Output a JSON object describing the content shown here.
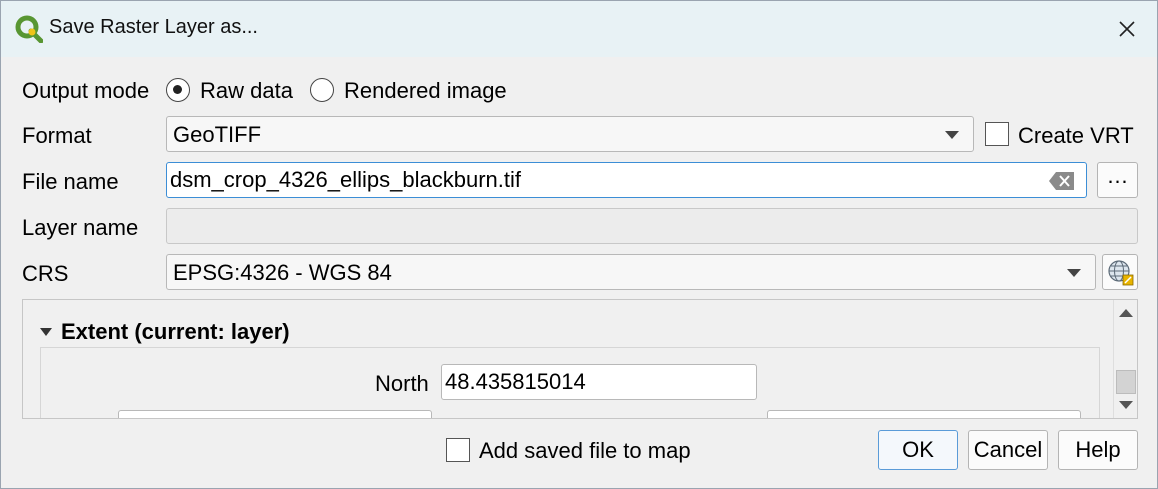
{
  "window": {
    "title": "Save Raster Layer as...",
    "app_icon": "qgis-logo-icon",
    "close_icon": "close-icon"
  },
  "output_mode": {
    "label": "Output mode",
    "options": [
      {
        "label": "Raw data",
        "checked": true
      },
      {
        "label": "Rendered image",
        "checked": false
      }
    ]
  },
  "format": {
    "label": "Format",
    "value": "GeoTIFF",
    "create_vrt_label": "Create VRT",
    "create_vrt_checked": false
  },
  "file_name": {
    "label": "File name",
    "value": "dsm_crop_4326_ellips_blackburn.tif",
    "clear_icon": "clear-text-icon",
    "browse_label": "…"
  },
  "layer_name": {
    "label": "Layer name",
    "value": ""
  },
  "crs": {
    "label": "CRS",
    "value": "EPSG:4326 - WGS 84",
    "select_icon": "globe-crs-icon"
  },
  "extent": {
    "title": "Extent (current: layer)",
    "expanded": true,
    "north_label": "North",
    "north_value": "48.435815014"
  },
  "footer": {
    "add_to_map_label": "Add saved file to map",
    "add_to_map_checked": false,
    "ok_label": "OK",
    "cancel_label": "Cancel",
    "help_label": "Help"
  },
  "colors": {
    "accent": "#3c8ed6",
    "titlebar": "#e8f2f5",
    "qgis_green": "#589632",
    "qgis_yellow": "#f0c419"
  }
}
